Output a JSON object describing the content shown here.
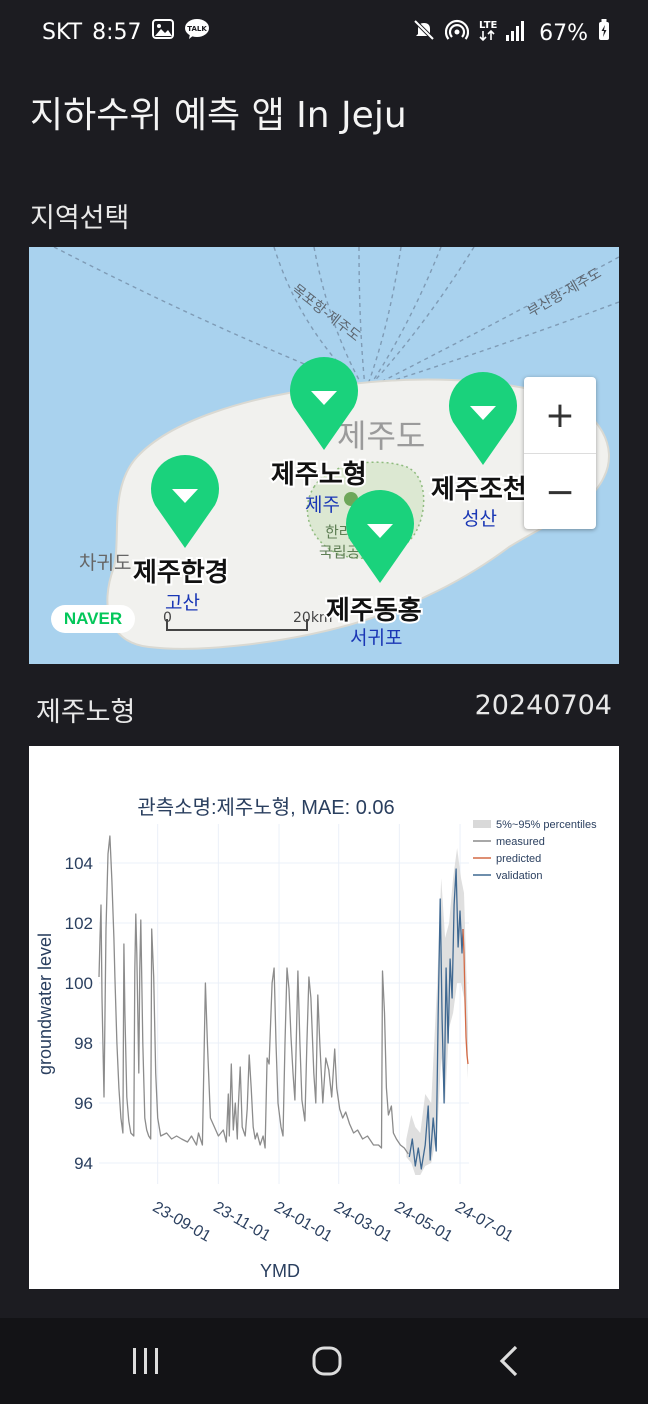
{
  "status_bar": {
    "carrier": "SKT",
    "time": "8:57",
    "network": "LTE",
    "battery": "67%"
  },
  "app": {
    "title": "지하수위 예측 앱 In Jeju"
  },
  "region_section": {
    "label": "지역선택"
  },
  "map": {
    "provider": "NAVER",
    "island_label": "제주도",
    "route_labels": [
      "목포항-제주도",
      "부산항-제주도"
    ],
    "place_labels": [
      "제주",
      "한라",
      "국립공",
      "차귀도",
      "고산",
      "성산",
      "서귀포"
    ],
    "stations": [
      "제주노형",
      "제주조천",
      "제주한경",
      "제주동홍"
    ],
    "scale": {
      "start": "0",
      "end": "20km"
    },
    "zoom_in": "+",
    "zoom_out": "−"
  },
  "selected": {
    "station": "제주노형",
    "date": "20240704"
  },
  "chart_data": {
    "type": "line",
    "title": "관측소명:제주노형, MAE: 0.06",
    "xlabel": "YMD",
    "ylabel": "groundwater level",
    "x_range": [
      "2023-07-04",
      "2024-07-10"
    ],
    "ylim": [
      93.3,
      105.3
    ],
    "x_ticks": [
      "23-09-01",
      "23-11-01",
      "24-01-01",
      "24-03-01",
      "24-05-01",
      "24-07-01"
    ],
    "y_ticks": [
      94,
      96,
      98,
      100,
      102,
      104
    ],
    "grid": true,
    "legend_position": "top-right",
    "legend": [
      "5%~95% percentiles",
      "measured",
      "predicted",
      "validation"
    ],
    "series": [
      {
        "name": "measured",
        "color": "#8c8c8c",
        "points": [
          [
            "2023-07-04",
            100.2
          ],
          [
            "2023-07-05",
            101.5
          ],
          [
            "2023-07-06",
            102.6
          ],
          [
            "2023-07-07",
            99.5
          ],
          [
            "2023-07-09",
            96.2
          ],
          [
            "2023-07-11",
            101.8
          ],
          [
            "2023-07-13",
            104.3
          ],
          [
            "2023-07-15",
            104.9
          ],
          [
            "2023-07-17",
            103.4
          ],
          [
            "2023-07-19",
            101.5
          ],
          [
            "2023-07-20",
            100.2
          ],
          [
            "2023-07-22",
            98.0
          ],
          [
            "2023-07-24",
            96.5
          ],
          [
            "2023-07-26",
            95.5
          ],
          [
            "2023-07-28",
            95.0
          ],
          [
            "2023-07-29",
            101.3
          ],
          [
            "2023-07-30",
            99.0
          ],
          [
            "2023-08-01",
            96.2
          ],
          [
            "2023-08-03",
            95.4
          ],
          [
            "2023-08-05",
            95.0
          ],
          [
            "2023-08-08",
            94.9
          ],
          [
            "2023-08-09",
            100.4
          ],
          [
            "2023-08-10",
            102.3
          ],
          [
            "2023-08-11",
            101.0
          ],
          [
            "2023-08-13",
            97.0
          ],
          [
            "2023-08-14",
            100.5
          ],
          [
            "2023-08-15",
            102.1
          ],
          [
            "2023-08-17",
            98.0
          ],
          [
            "2023-08-19",
            95.5
          ],
          [
            "2023-08-21",
            95.1
          ],
          [
            "2023-08-23",
            94.9
          ],
          [
            "2023-08-25",
            94.8
          ],
          [
            "2023-08-26",
            101.8
          ],
          [
            "2023-08-28",
            100.2
          ],
          [
            "2023-08-30",
            97.0
          ],
          [
            "2023-09-01",
            95.5
          ],
          [
            "2023-09-04",
            94.9
          ],
          [
            "2023-09-10",
            95.0
          ],
          [
            "2023-09-15",
            94.8
          ],
          [
            "2023-09-20",
            94.9
          ],
          [
            "2023-09-25",
            94.8
          ],
          [
            "2023-10-01",
            94.7
          ],
          [
            "2023-10-05",
            94.9
          ],
          [
            "2023-10-10",
            94.6
          ],
          [
            "2023-10-12",
            95.0
          ],
          [
            "2023-10-16",
            94.6
          ],
          [
            "2023-10-19",
            100.0
          ],
          [
            "2023-10-21",
            98.0
          ],
          [
            "2023-10-24",
            95.5
          ],
          [
            "2023-10-28",
            95.2
          ],
          [
            "2023-11-01",
            94.9
          ],
          [
            "2023-11-06",
            95.1
          ],
          [
            "2023-11-09",
            94.7
          ],
          [
            "2023-11-11",
            96.3
          ],
          [
            "2023-11-12",
            94.9
          ],
          [
            "2023-11-14",
            97.3
          ],
          [
            "2023-11-16",
            95.1
          ],
          [
            "2023-11-18",
            96.0
          ],
          [
            "2023-11-20",
            94.8
          ],
          [
            "2023-11-21",
            95.8
          ],
          [
            "2023-11-23",
            97.2
          ],
          [
            "2023-11-25",
            95.2
          ],
          [
            "2023-11-28",
            94.9
          ],
          [
            "2023-11-30",
            95.8
          ],
          [
            "2023-12-02",
            97.6
          ],
          [
            "2023-12-04",
            96.5
          ],
          [
            "2023-12-06",
            95.2
          ],
          [
            "2023-12-08",
            94.8
          ],
          [
            "2023-12-10",
            95.0
          ],
          [
            "2023-12-13",
            94.6
          ],
          [
            "2023-12-16",
            94.9
          ],
          [
            "2023-12-18",
            94.5
          ],
          [
            "2023-12-20",
            97.5
          ],
          [
            "2023-12-22",
            97.3
          ],
          [
            "2023-12-25",
            100.0
          ],
          [
            "2023-12-27",
            100.5
          ],
          [
            "2023-12-29",
            98.0
          ],
          [
            "2023-12-31",
            96.0
          ],
          [
            "2024-01-03",
            95.2
          ],
          [
            "2024-01-05",
            94.9
          ],
          [
            "2024-01-07",
            98.0
          ],
          [
            "2024-01-09",
            100.5
          ],
          [
            "2024-01-11",
            99.8
          ],
          [
            "2024-01-13",
            98.2
          ],
          [
            "2024-01-15",
            97.0
          ],
          [
            "2024-01-17",
            96.1
          ],
          [
            "2024-01-20",
            100.4
          ],
          [
            "2024-01-22",
            98.0
          ],
          [
            "2024-01-24",
            96.1
          ],
          [
            "2024-01-27",
            95.4
          ],
          [
            "2024-01-29",
            98.0
          ],
          [
            "2024-01-31",
            100.2
          ],
          [
            "2024-02-02",
            99.5
          ],
          [
            "2024-02-05",
            97.0
          ],
          [
            "2024-02-07",
            96.0
          ],
          [
            "2024-02-09",
            99.6
          ],
          [
            "2024-02-11",
            98.0
          ],
          [
            "2024-02-14",
            96.0
          ],
          [
            "2024-02-17",
            97.5
          ],
          [
            "2024-02-20",
            97.1
          ],
          [
            "2024-02-23",
            96.2
          ],
          [
            "2024-02-26",
            97.8
          ],
          [
            "2024-02-28",
            96.5
          ],
          [
            "2024-03-02",
            95.8
          ],
          [
            "2024-03-05",
            95.5
          ],
          [
            "2024-03-08",
            95.7
          ],
          [
            "2024-03-12",
            95.3
          ],
          [
            "2024-03-16",
            95.0
          ],
          [
            "2024-03-20",
            95.1
          ],
          [
            "2024-03-25",
            94.8
          ],
          [
            "2024-03-30",
            94.9
          ],
          [
            "2024-04-05",
            94.6
          ],
          [
            "2024-04-10",
            94.6
          ],
          [
            "2024-04-13",
            94.5
          ],
          [
            "2024-04-14",
            100.4
          ],
          [
            "2024-04-16",
            99.0
          ],
          [
            "2024-04-18",
            96.5
          ],
          [
            "2024-04-20",
            95.6
          ],
          [
            "2024-04-23",
            95.9
          ],
          [
            "2024-04-25",
            95.0
          ],
          [
            "2024-04-28",
            94.8
          ],
          [
            "2024-05-02",
            94.6
          ],
          [
            "2024-05-06",
            94.5
          ],
          [
            "2024-05-10",
            94.3
          ]
        ]
      },
      {
        "name": "validation",
        "color": "#3f6891",
        "points": [
          [
            "2024-05-11",
            94.2
          ],
          [
            "2024-05-14",
            94.8
          ],
          [
            "2024-05-17",
            93.9
          ],
          [
            "2024-05-20",
            94.5
          ],
          [
            "2024-05-23",
            93.8
          ],
          [
            "2024-05-27",
            94.6
          ],
          [
            "2024-05-30",
            95.9
          ],
          [
            "2024-06-01",
            94.1
          ],
          [
            "2024-06-04",
            95.5
          ],
          [
            "2024-06-07",
            94.4
          ],
          [
            "2024-06-09",
            99.0
          ],
          [
            "2024-06-11",
            102.8
          ],
          [
            "2024-06-13",
            98.8
          ],
          [
            "2024-06-15",
            96.0
          ],
          [
            "2024-06-17",
            100.5
          ],
          [
            "2024-06-19",
            98.0
          ],
          [
            "2024-06-21",
            100.8
          ],
          [
            "2024-06-23",
            99.5
          ],
          [
            "2024-06-25",
            102.6
          ],
          [
            "2024-06-27",
            103.8
          ],
          [
            "2024-06-29",
            101.2
          ],
          [
            "2024-07-01",
            102.4
          ],
          [
            "2024-07-03",
            101.0
          ],
          [
            "2024-07-04",
            101.8
          ]
        ]
      },
      {
        "name": "predicted",
        "color": "#d46a45",
        "points": [
          [
            "2024-07-04",
            101.8
          ],
          [
            "2024-07-05",
            101.0
          ],
          [
            "2024-07-06",
            99.5
          ],
          [
            "2024-07-07",
            98.2
          ],
          [
            "2024-07-08",
            97.6
          ],
          [
            "2024-07-09",
            97.3
          ]
        ]
      }
    ],
    "percentile_band": {
      "name": "5%~95% percentiles",
      "color": "#d9d9d9",
      "points": [
        [
          "2024-05-08",
          94.2,
          94.8
        ],
        [
          "2024-05-13",
          94.0,
          95.6
        ],
        [
          "2024-05-17",
          93.6,
          95.2
        ],
        [
          "2024-05-22",
          93.6,
          95.0
        ],
        [
          "2024-05-27",
          93.9,
          96.3
        ],
        [
          "2024-06-02",
          94.0,
          96.0
        ],
        [
          "2024-06-08",
          95.0,
          100.0
        ],
        [
          "2024-06-12",
          97.5,
          103.5
        ],
        [
          "2024-06-16",
          96.0,
          101.5
        ],
        [
          "2024-06-20",
          98.5,
          102.0
        ],
        [
          "2024-06-24",
          99.0,
          103.5
        ],
        [
          "2024-06-28",
          100.0,
          104.5
        ],
        [
          "2024-07-02",
          100.0,
          103.5
        ],
        [
          "2024-07-05",
          99.5,
          103.0
        ],
        [
          "2024-07-09",
          96.8,
          98.5
        ]
      ]
    }
  }
}
